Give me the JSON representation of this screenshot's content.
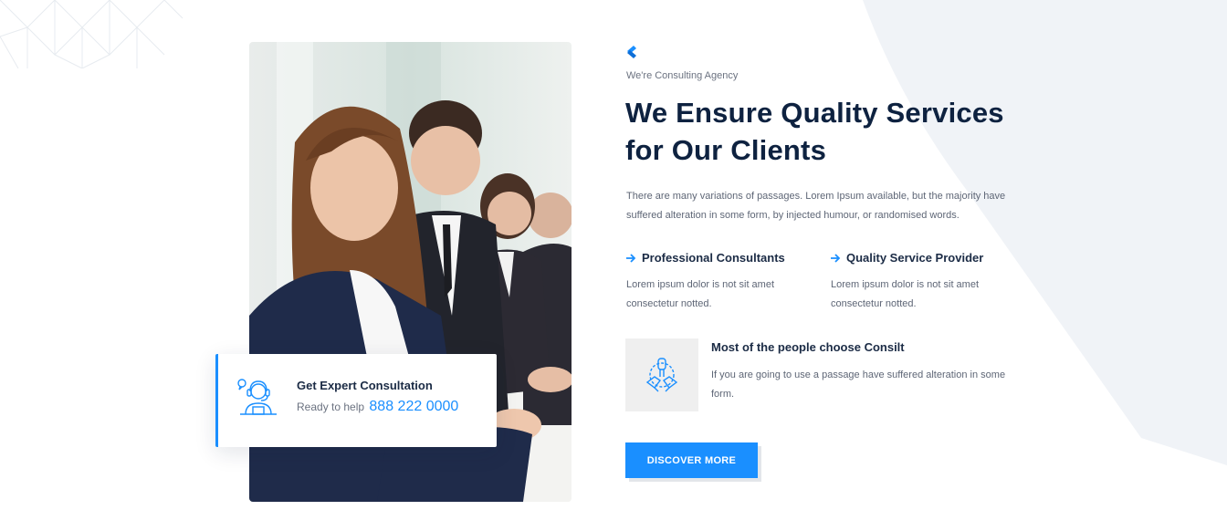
{
  "brand": {
    "accent": "#1a8fff",
    "heading": "#0e2240",
    "bg_shape": "#f0f3f7"
  },
  "icons": {
    "logo": "consult-logo-icon",
    "consult": "support-agent-icon",
    "feature": "arrow-right-icon",
    "choose": "hands-teamwork-icon"
  },
  "about": {
    "tagline": "We're Consulting Agency",
    "headline_line1": "We Ensure Quality Services",
    "headline_line2": "for Our Clients",
    "intro": "There are many variations of passages. Lorem Ipsum available, but the majority have suffered alteration in some form, by injected humour, or randomised words.",
    "features": [
      {
        "title": "Professional Consultants",
        "text": "Lorem ipsum dolor is not sit amet consectetur notted."
      },
      {
        "title": "Quality Service Provider",
        "text": "Lorem ipsum dolor is not sit amet consectetur notted."
      }
    ],
    "choose_title": "Most of the people choose Consilt",
    "choose_text": "If you are going to use a passage have suffered alteration in some form.",
    "cta_label": "DISCOVER MORE"
  },
  "consult_card": {
    "title": "Get Expert Consultation",
    "prefix": "Ready to help",
    "phone": "888 222 0000"
  }
}
